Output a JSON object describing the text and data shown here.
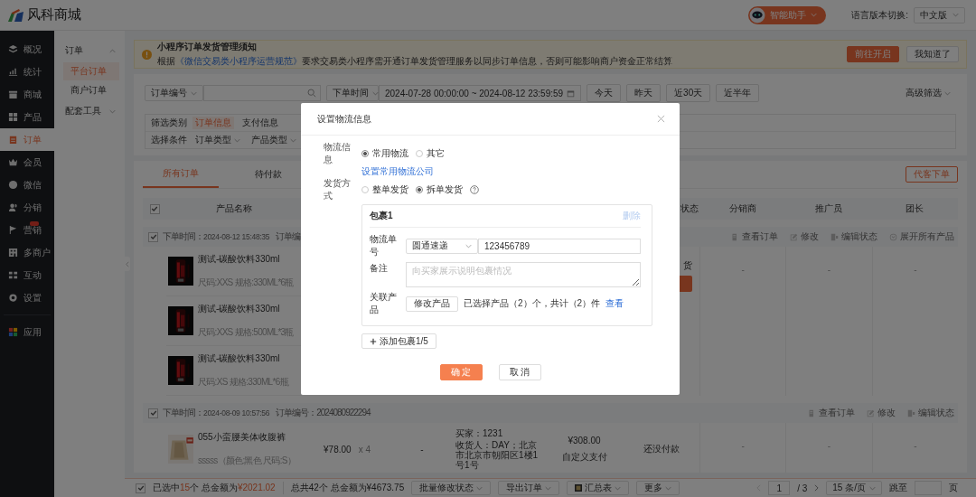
{
  "header": {
    "logo_text": "风科商城",
    "assistant": "智能助手",
    "language_label": "语言版本切换:",
    "language": "中文版"
  },
  "sidebar": [
    {
      "label": "概况",
      "selected": false,
      "badge": false
    },
    {
      "label": "统计",
      "selected": false,
      "badge": false
    },
    {
      "label": "商城",
      "selected": false,
      "badge": false
    },
    {
      "label": "产品",
      "selected": false,
      "badge": false
    },
    {
      "label": "订单",
      "selected": true,
      "badge": false
    },
    {
      "label": "会员",
      "selected": false,
      "badge": false
    },
    {
      "label": "微信",
      "selected": false,
      "badge": false
    },
    {
      "label": "分销",
      "selected": false,
      "badge": false
    },
    {
      "label": "营销",
      "selected": false,
      "badge": true
    },
    {
      "label": "多商户",
      "selected": false,
      "badge": false
    },
    {
      "label": "互动",
      "selected": false,
      "badge": false
    },
    {
      "label": "设置",
      "selected": false,
      "badge": false
    },
    {
      "label": "应用",
      "selected": false,
      "badge": false
    }
  ],
  "subnav": [
    {
      "label": "订单",
      "expanded": true,
      "children": [
        {
          "label": "平台订单",
          "selected": true
        },
        {
          "label": "商户订单",
          "selected": false
        }
      ]
    },
    {
      "label": "配套工具",
      "expanded": false
    }
  ],
  "notice": {
    "title": "小程序订单发货管理须知",
    "text_before": "根据",
    "link": "《微信交易类小程序运营规范》",
    "text_after": "要求交易类小程序需开通订单发货管理服务以同步订单信息，否则可能影响商户资金正常结算",
    "buttons": [
      {
        "label": "前往开启",
        "kind": "primary"
      },
      {
        "label": "我知道了",
        "kind": "default"
      }
    ]
  },
  "search": {
    "field": "订单编号",
    "time_field": "下单时间",
    "date_start": "2024-07-28 00:00:00",
    "date_sep": "~",
    "date_end": "2024-08-12 23:59:59",
    "quick": [
      "今天",
      "昨天",
      "近30天",
      "近半年"
    ],
    "advanced": "高级筛选"
  },
  "filter": {
    "category_label": "筛选类别",
    "categories": [
      {
        "label": "订单信息",
        "selected": true
      },
      {
        "label": "支付信息",
        "selected": false
      }
    ],
    "condition_label": "选择条件",
    "conditions": [
      "订单类型",
      "产品类型"
    ]
  },
  "tabs": [
    {
      "label": "所有订单",
      "selected": true
    },
    {
      "label": "待付款",
      "selected": false
    }
  ],
  "create_button": "代客下单",
  "table": {
    "checked": true,
    "columns": [
      "产品名称",
      "状态",
      "分销商",
      "推广员",
      "团长"
    ]
  },
  "orders": [
    {
      "checked": true,
      "time_label": "下单时间：",
      "time": "2024-08-12 15:48:35",
      "number": "订单编",
      "actions": [
        "查看订单",
        "修改",
        "编辑状态",
        "展开所有产品"
      ],
      "items": [
        {
          "kind": "can",
          "name": "测试-碳酸饮料330ml",
          "spec": "尺码:XXS 规格:330ML*6瓶"
        },
        {
          "kind": "can",
          "name": "测试-碳酸饮料330ml",
          "spec": "尺码:XXS 规格:500ML*3瓶"
        },
        {
          "kind": "can",
          "name": "测试-碳酸饮料330ml",
          "spec": "尺码:XS 规格:330ML*6瓶"
        }
      ],
      "status": "货",
      "action_button": true,
      "distributor": "-",
      "promoter": "-",
      "leader": "-"
    },
    {
      "checked": true,
      "time_label": "下单时间：",
      "time": "2024-08-09 10:57:56",
      "number": "订单编号：2024080922294",
      "actions": [
        "查看订单",
        "修改",
        "编辑状态"
      ],
      "items": [
        {
          "kind": "garment",
          "name": "055小蛮腰美体收腹裤",
          "spec": "sssss（颜色:黑色 尺码:S）",
          "price": "¥78.00",
          "qty": "x 4"
        }
      ],
      "column_4": "-",
      "buyer": "买家：1231",
      "consignee": "收货人：DAY；北京市北京市朝阳区1楼1号1号",
      "amount": "¥308.00",
      "payment": "自定义支付",
      "status": "还没付款",
      "action_button": false,
      "distributor": "-",
      "promoter": "-",
      "leader": "-"
    }
  ],
  "footer": {
    "checked": true,
    "selected_prefix": "已选中",
    "selected_count": "15",
    "selected_mid": "个 总金额为",
    "selected_amount": "¥2021.02",
    "total": "总共42个 总金额为¥4673.75",
    "actions": [
      "批量修改状态",
      "导出订单",
      "汇总表",
      "更多"
    ],
    "page": "1",
    "pages": "/ 3",
    "page_size": "15 条/页",
    "jump_label": "跳至",
    "page_unit": "页"
  },
  "dialog": {
    "title": "设置物流信息",
    "logistics_label": "物流信息",
    "logistics_options": [
      {
        "label": "常用物流",
        "selected": true
      },
      {
        "label": "其它",
        "selected": false
      }
    ],
    "logistics_link": "设置常用物流公司",
    "ship_label": "发货方式",
    "ship_options": [
      {
        "label": "整单发货",
        "selected": false
      },
      {
        "label": "拆单发货",
        "selected": true
      }
    ],
    "package": {
      "title": "包裹1",
      "delete": "删除",
      "delete_disabled": true,
      "tracking_label": "物流单号",
      "carrier": "圆通速递",
      "tracking_number": "123456789",
      "note_label": "备注",
      "note_placeholder": "向买家展示说明包裹情况",
      "products_label": "关联产品",
      "edit_products": "修改产品",
      "summary": "已选择产品（2）个，共计（2）件",
      "view": "查看"
    },
    "add_package": "添加包裹1/5",
    "confirm": "确 定",
    "cancel": "取 消"
  }
}
